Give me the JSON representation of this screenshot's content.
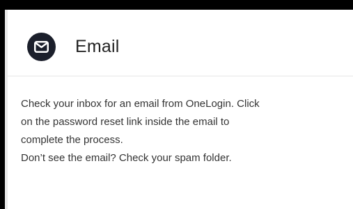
{
  "card": {
    "icon": "envelope-icon",
    "title": "Email",
    "message_lines": [
      "Check your inbox for an email from OneLogin. Click",
      "on the password reset link inside the email to",
      "complete the process."
    ],
    "spam_note": "Don’t see the email? Check your spam folder."
  },
  "colors": {
    "icon_background": "#1b1f2b",
    "text": "#333333",
    "title": "#222222"
  }
}
